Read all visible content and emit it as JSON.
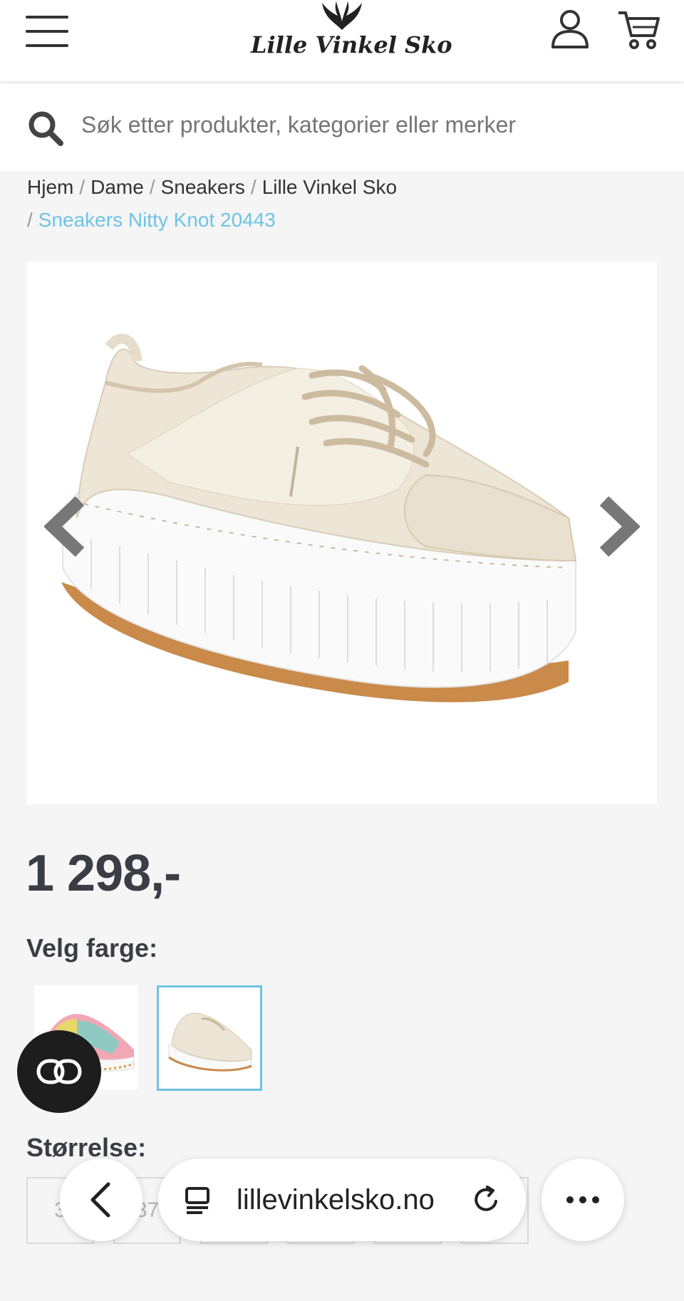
{
  "header": {
    "brand_name": "Lille Vinkel Sko"
  },
  "search": {
    "placeholder": "Søk etter produkter, kategorier eller merker"
  },
  "breadcrumb": {
    "items": [
      "Hjem",
      "Dame",
      "Sneakers",
      "Lille Vinkel Sko"
    ],
    "current": "Sneakers Nitty Knot 20443",
    "separator": "/"
  },
  "product": {
    "price": "1 298,-",
    "color_label": "Velg farge",
    "size_label": "Størrelse",
    "sizes_visible": [
      "3",
      "37"
    ]
  },
  "browser": {
    "url": "lillevinkelsko.no"
  },
  "colors": {
    "accent": "#6cc3e6",
    "price_text": "#3a3d45",
    "fab": "#1d1d1d"
  },
  "icons": {
    "menu": "hamburger-icon",
    "user": "user-icon",
    "cart": "cart-icon",
    "search": "search-icon",
    "prev": "chevron-left-icon",
    "next": "chevron-right-icon",
    "back": "back-arrow-icon",
    "tabs": "tabs-icon",
    "reload": "reload-icon",
    "more": "more-dots-icon",
    "fab": "link-icon"
  }
}
